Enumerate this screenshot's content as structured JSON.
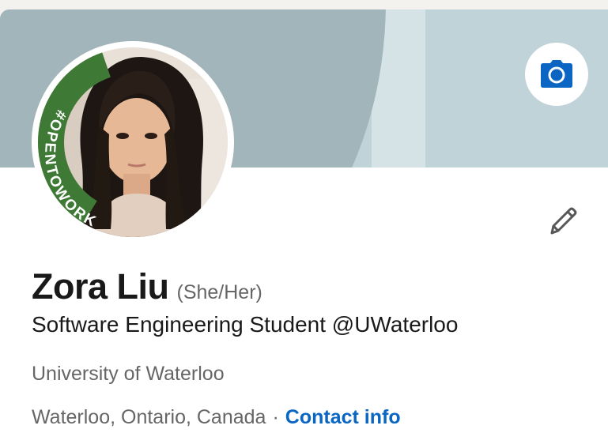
{
  "profile": {
    "name": "Zora Liu",
    "pronouns": "(She/Her)",
    "headline": "Software Engineering Student @UWaterloo",
    "school": "University of Waterloo",
    "location": "Waterloo, Ontario, Canada",
    "separator": "·",
    "contact_label": "Contact info",
    "open_to_work_badge": "#OPENTOWORK"
  },
  "icons": {
    "banner_action": "camera-icon",
    "edit_action": "pencil-icon"
  },
  "colors": {
    "link": "#0a66c2",
    "badge_green": "#3e7a35",
    "banner_dark": "#a1b5ba",
    "banner_light": "#bfd3d8",
    "camera_icon": "#0a66c2"
  }
}
